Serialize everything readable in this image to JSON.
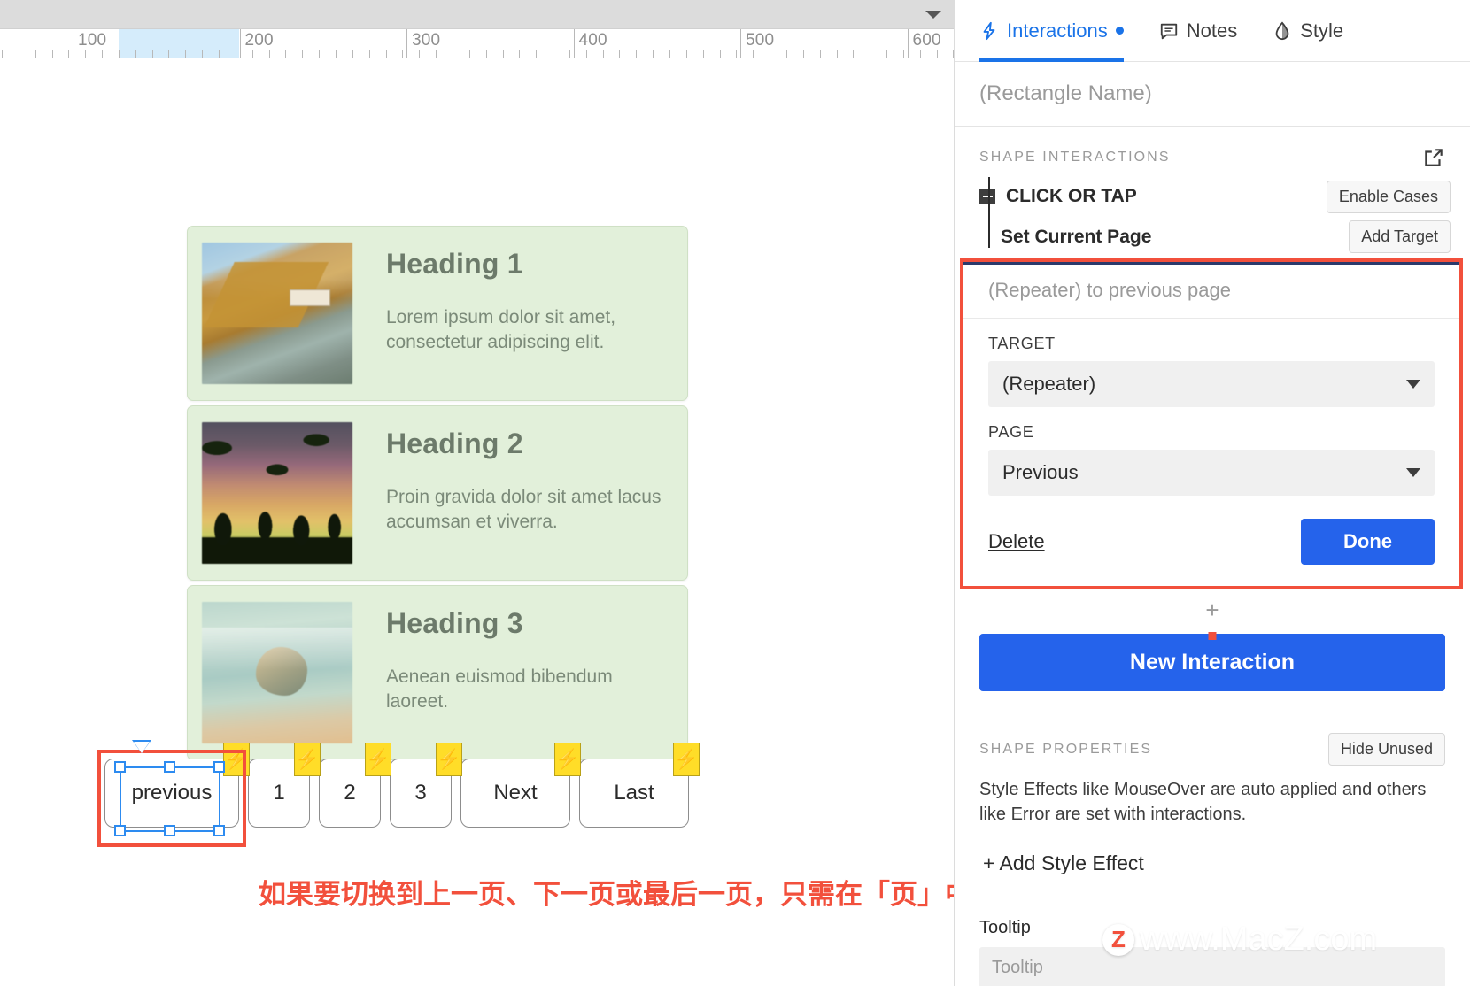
{
  "canvas": {
    "toolbar": {
      "caret_icon": "chevron-down-icon"
    },
    "ruler": {
      "labels": [
        "100",
        "200",
        "300",
        "400",
        "500",
        "600"
      ],
      "selection_start": "100",
      "selection_end": "190"
    },
    "cards": [
      {
        "heading": "Heading 1",
        "text": "Lorem ipsum dolor sit amet, consectetur adipiscing elit.",
        "image": "coastal-cliff-photo"
      },
      {
        "heading": "Heading 2",
        "text": "Proin gravida dolor sit amet lacus accumsan et viverra.",
        "image": "palm-sunset-photo"
      },
      {
        "heading": "Heading 3",
        "text": "Aenean euismod bibendum laoreet.",
        "image": "beach-rock-photo"
      }
    ],
    "pagination": [
      {
        "label": "previous",
        "width": "w-previous",
        "selected": true
      },
      {
        "label": "1",
        "width": "w-num",
        "selected": false
      },
      {
        "label": "2",
        "width": "w-num",
        "selected": false
      },
      {
        "label": "3",
        "width": "w-num",
        "selected": false
      },
      {
        "label": "Next",
        "width": "w-wide",
        "selected": false
      },
      {
        "label": "Last",
        "width": "w-wide",
        "selected": false
      }
    ],
    "annotation": "如果要切换到上一页、下一页或最后一页，只需在「页」中设置即可",
    "watermark": {
      "badge": "Z",
      "text": "www.MacZ.com"
    }
  },
  "panel": {
    "tabs": [
      {
        "label": "Interactions",
        "icon": "lightning-bolt-icon",
        "active": true,
        "dot": true
      },
      {
        "label": "Notes",
        "icon": "comment-icon",
        "active": false,
        "dot": false
      },
      {
        "label": "Style",
        "icon": "style-droplet-icon",
        "active": false,
        "dot": false
      }
    ],
    "shape_name_placeholder": "(Rectangle Name)",
    "shape_interactions": {
      "title": "SHAPE INTERACTIONS",
      "expand_icon": "external-link-icon",
      "event_label": "CLICK OR TAP",
      "enable_cases_label": "Enable Cases",
      "action_label": "Set Current Page",
      "add_target_label": "Add Target"
    },
    "editor": {
      "summary": "(Repeater) to previous page",
      "target_label": "TARGET",
      "target_value": "(Repeater)",
      "page_label": "PAGE",
      "page_value": "Previous",
      "delete_label": "Delete",
      "done_label": "Done"
    },
    "add_case_icon": "plus-icon",
    "new_interaction_label": "New Interaction",
    "shape_properties": {
      "title": "SHAPE PROPERTIES",
      "hide_unused_label": "Hide Unused",
      "description": "Style Effects like MouseOver are auto applied and others like Error are set with interactions.",
      "add_style_effect_label": "+ Add Style Effect",
      "tooltip_label": "Tooltip",
      "tooltip_placeholder": "Tooltip"
    }
  }
}
